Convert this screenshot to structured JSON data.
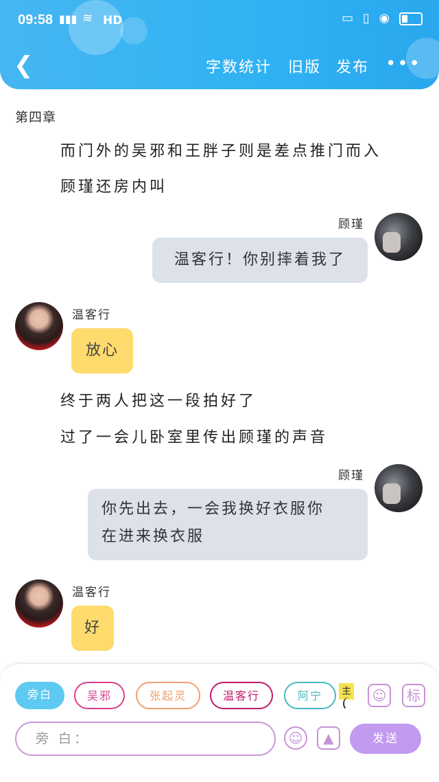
{
  "status_bar": {
    "time": "09:58",
    "network": "4G",
    "hd": "HD"
  },
  "header": {
    "menu": [
      "字数统计",
      "旧版",
      "发布"
    ],
    "more": "•••"
  },
  "content": {
    "chapter": "第四章",
    "narration_1": "而门外的吴邪和王胖子则是差点推门而入",
    "narration_2": "顾瑾还房内叫",
    "msg1": {
      "speaker": "顾瑾",
      "text": "温客行！你别摔着我了"
    },
    "msg2": {
      "speaker": "温客行",
      "text": "放心"
    },
    "narration_3": "终于两人把这一段拍好了",
    "narration_4": "过了一会儿卧室里传出顾瑾的声音",
    "msg3": {
      "speaker": "顾瑾",
      "line1": "你先出去，一会我换好衣服你",
      "line2": "在进来换衣服"
    },
    "msg4": {
      "speaker": "温客行",
      "text": "好"
    }
  },
  "bottom": {
    "roles": [
      "旁白",
      "吴邪",
      "张起灵",
      "温客行",
      "阿宁"
    ],
    "main_tag": "主",
    "user_icon": "user-card-icon",
    "tag_label": "标",
    "input_placeholder": "旁 白：",
    "emoji_icon": "emoji-icon",
    "image_icon": "image-icon",
    "send_label": "发送"
  },
  "colors": {
    "header": "#2fb2f3",
    "right_bubble": "#dce1ea",
    "left_bubble": "#fedb6c",
    "accent": "#c29af0"
  }
}
